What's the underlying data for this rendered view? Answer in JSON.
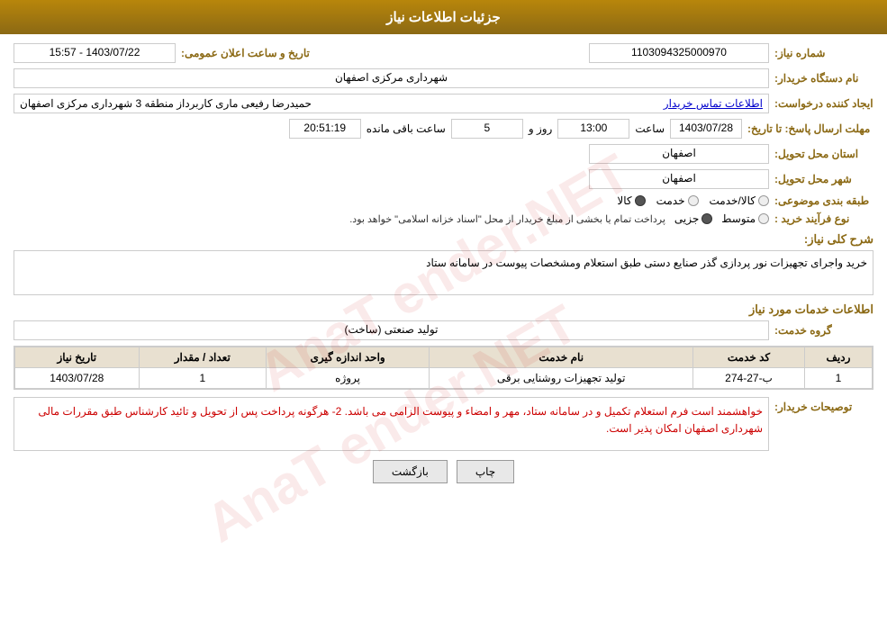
{
  "header": {
    "title": "جزئیات اطلاعات نیاز"
  },
  "fields": {
    "need_number_label": "شماره نیاز:",
    "need_number_value": "1103094325000970",
    "buyer_org_label": "نام دستگاه خریدار:",
    "buyer_org_value": "شهرداری مرکزی اصفهان",
    "requester_label": "ایجاد کننده درخواست:",
    "requester_value": "حمیدرضا رفیعی ماری کاربرداز منطقه 3 شهرداری مرکزی اصفهان",
    "requester_link": "اطلاعات تماس خریدار",
    "deadline_label": "مهلت ارسال پاسخ: تا تاریخ:",
    "deadline_date": "1403/07/28",
    "deadline_time": "13:00",
    "deadline_days_label": "روز و",
    "deadline_days": "5",
    "deadline_remaining_label": "ساعت باقی مانده",
    "deadline_remaining": "20:51:19",
    "province_label": "استان محل تحویل:",
    "province_value": "اصفهان",
    "city_label": "شهر محل تحویل:",
    "city_value": "اصفهان",
    "category_label": "طبقه بندی موضوعی:",
    "category_options": [
      "کالا",
      "خدمت",
      "کالا/خدمت"
    ],
    "category_selected": "کالا",
    "purchase_type_label": "نوع فرآیند خرید :",
    "purchase_type_options": [
      "جزیی",
      "متوسط"
    ],
    "purchase_type_note": "پرداخت تمام یا بخشی از مبلغ خریدار از محل \"اسناد خزانه اسلامی\" خواهد بود.",
    "public_announce_label": "تاریخ و ساعت اعلان عمومی:",
    "public_announce_value": "1403/07/22 - 15:57",
    "description_title": "شرح کلی نیاز:",
    "description_value": "خرید واجرای تجهیزات نور پردازی گذر صنایع دستی طبق استعلام ومشخصات پیوست در سامانه ستاد",
    "services_title": "اطلاعات خدمات مورد نیاز",
    "service_group_label": "گروه خدمت:",
    "service_group_value": "تولید صنعتی (ساخت)",
    "table": {
      "columns": [
        "ردیف",
        "کد خدمت",
        "نام خدمت",
        "واحد اندازه گیری",
        "تعداد / مقدار",
        "تاریخ نیاز"
      ],
      "rows": [
        {
          "row": "1",
          "code": "ب-27-274",
          "name": "تولید تجهیزات روشنایی برقی",
          "unit": "پروژه",
          "qty": "1",
          "date": "1403/07/28"
        }
      ]
    },
    "buyer_notes_label": "توصیحات خریدار:",
    "buyer_notes_value": "خواهشمند است فرم استعلام  تکمیل و در سامانه ستاد، مهر و امضاء و پیوست الزامی می باشد.\n2- هرگونه پرداخت پس از تحویل و تائید کارشناس طبق مقررات مالی شهرداری اصفهان امکان پذیر است.",
    "buttons": {
      "print": "چاپ",
      "back": "بازگشت"
    }
  }
}
